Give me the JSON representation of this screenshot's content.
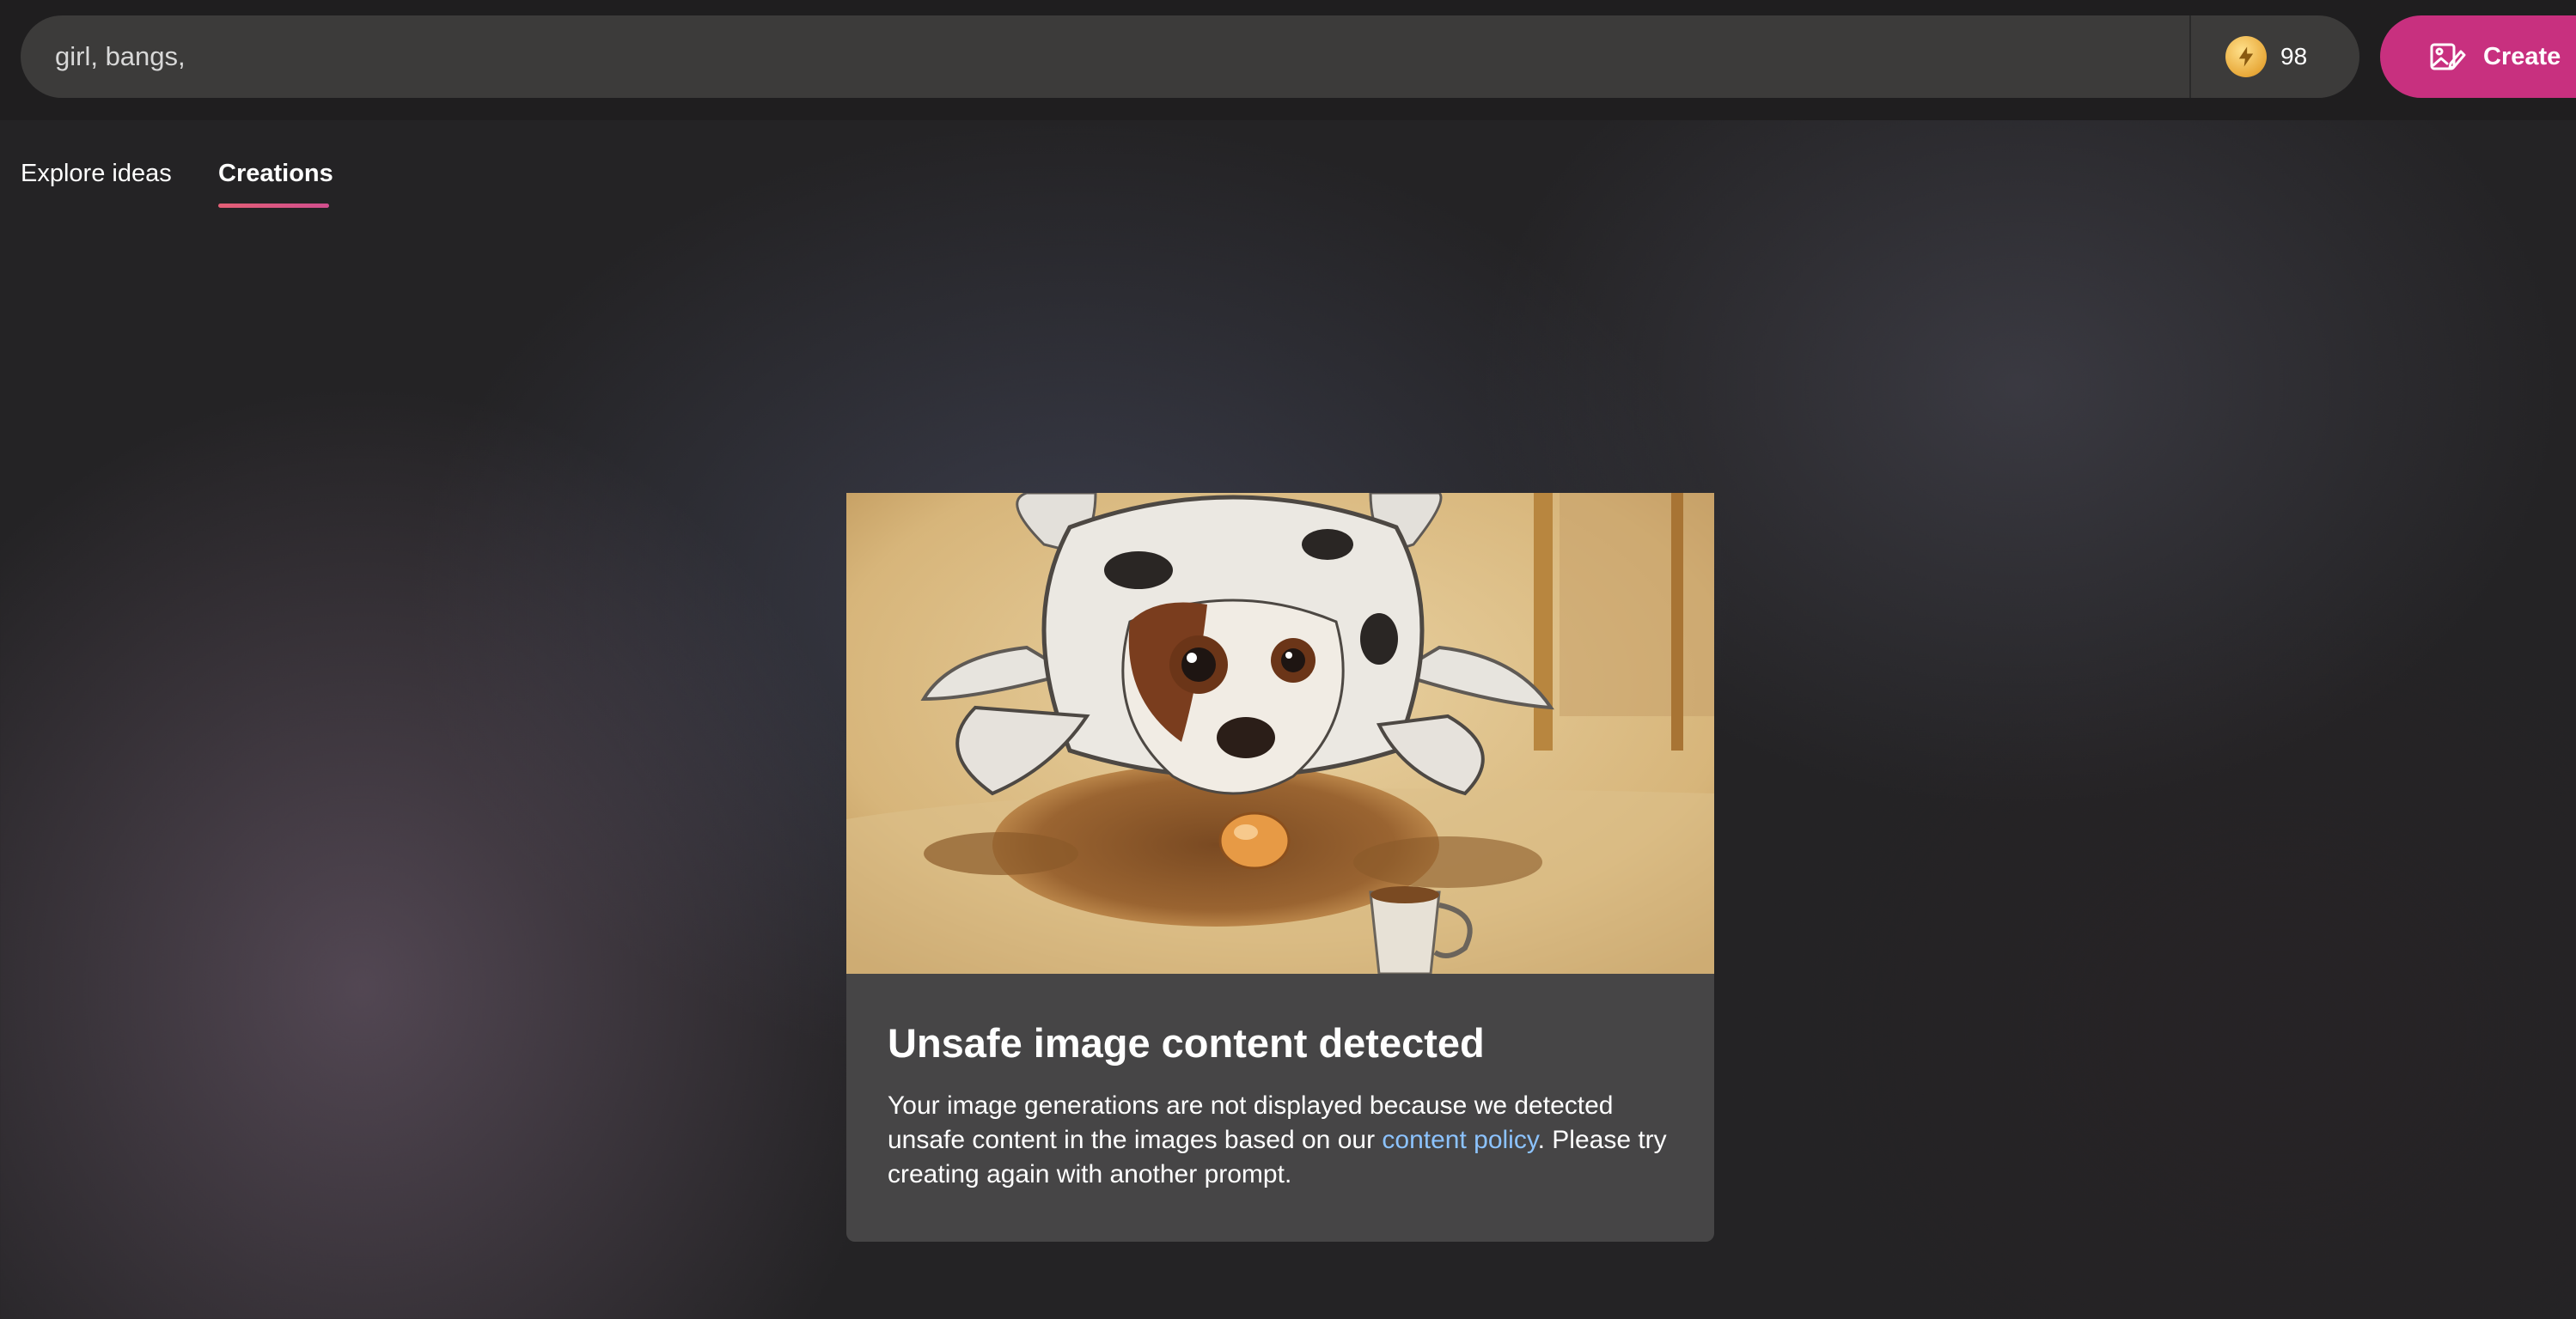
{
  "search": {
    "value": "girl, bangs,",
    "placeholder": ""
  },
  "credits": {
    "count": "98",
    "icon": "lightning-coin-icon"
  },
  "create_button": {
    "label": "Create",
    "icon": "image-edit-icon"
  },
  "tabs": [
    {
      "label": "Explore ideas",
      "active": false
    },
    {
      "label": "Creations",
      "active": true
    }
  ],
  "notice": {
    "title": "Unsafe image content detected",
    "text_before": "Your image generations are not displayed because we detected unsafe content in the images based on our ",
    "link_label": "content policy",
    "text_after": ". Please try creating again with another prompt.",
    "image": "painting-of-dog-in-cow-costume-with-spilled-coffee"
  },
  "colors": {
    "accent": "#c8307f",
    "tab_underline": "#e35f75",
    "link": "#8cc3ff",
    "card_background": "#464546"
  }
}
